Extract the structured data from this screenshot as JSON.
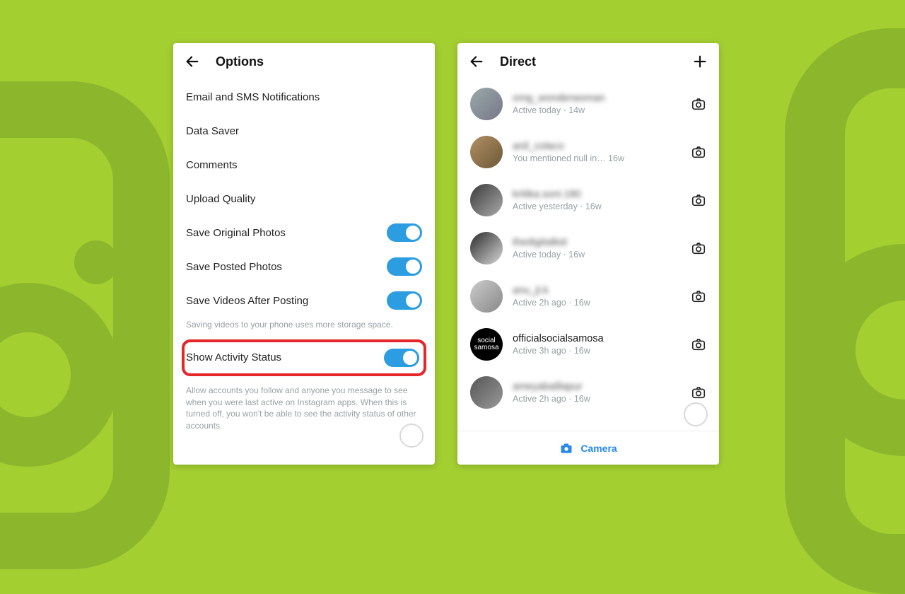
{
  "colors": {
    "accent": "#2b9de0",
    "highlight": "#e52527",
    "link": "#2b88e6"
  },
  "options": {
    "title": "Options",
    "rows": [
      {
        "label": "Email and SMS Notifications"
      },
      {
        "label": "Data Saver"
      },
      {
        "label": "Comments"
      },
      {
        "label": "Upload Quality"
      },
      {
        "label": "Save Original Photos",
        "toggle": true
      },
      {
        "label": "Save Posted Photos",
        "toggle": true
      },
      {
        "label": "Save Videos After Posting",
        "toggle": true
      }
    ],
    "save_videos_helper": "Saving videos to your phone uses more storage space.",
    "activity": {
      "label": "Show Activity Status",
      "toggle": true,
      "helper": "Allow accounts you follow and anyone you message to see when you were last active on Instagram apps. When this is turned off, you won't be able to see the activity status of other accounts."
    }
  },
  "direct": {
    "title": "Direct",
    "footer_label": "Camera",
    "chats": [
      {
        "name": "omg_wonderwoman",
        "sub": "Active today · 14w",
        "blurred": true
      },
      {
        "name": "anil_colaco",
        "sub": "You mentioned null in…    16w",
        "blurred": true
      },
      {
        "name": "kritika.soni.180",
        "sub": "Active yesterday · 16w",
        "blurred": true
      },
      {
        "name": "thedigitalkid",
        "sub": "Active today · 16w",
        "blurred": true
      },
      {
        "name": "anu_jt.k",
        "sub": "Active 2h ago · 16w",
        "blurred": true
      },
      {
        "name": "officialsocialsamosa",
        "sub": "Active 3h ago · 16w",
        "blurred": false,
        "social": true
      },
      {
        "name": "ameyabaillapur",
        "sub": "Active 2h ago · 16w",
        "blurred": true
      }
    ]
  }
}
